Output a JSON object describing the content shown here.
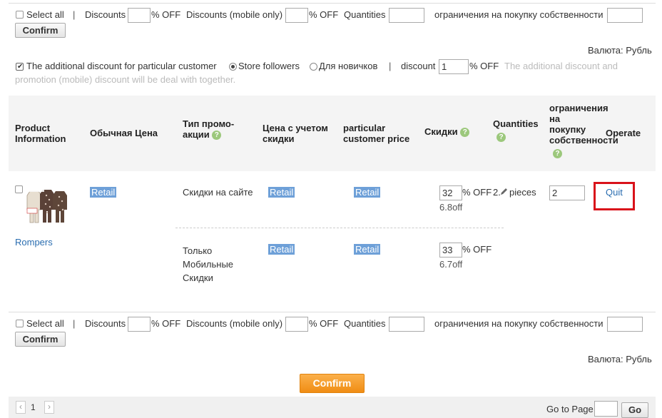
{
  "bulk_top": {
    "select_all": "Select all",
    "separator": "|",
    "discounts_label": "Discounts",
    "off_label": "% OFF",
    "discounts_mobile_label": "Discounts (mobile only)",
    "quantities_label": "Quantities",
    "restrictions_label": "ограничения на покупку собственности",
    "confirm": "Confirm"
  },
  "currency": "Валюта: Рубль",
  "customer_discount": {
    "label": "The additional discount for particular customer",
    "option_followers": "Store followers",
    "option_newcomers": "Для новичков",
    "separator": "|",
    "discount_label": "discount",
    "discount_value": "1",
    "off_label": "% OFF",
    "note_line1": "The additional discount and",
    "note_line2": "promotion (mobile) discount will be deal with together."
  },
  "table": {
    "headers": {
      "product_1": "Product",
      "product_2": "Information",
      "price": "Обычная Цена",
      "promo_type_1": "Тип промо-",
      "promo_type_2": "акции",
      "discounted_price_1": "Цена с учетом",
      "discounted_price_2": "скидки",
      "customer_price_1": "particular",
      "customer_price_2": "customer price",
      "discounts": "Скидки",
      "quantities": "Quantities",
      "restrictions_1": "ограничения",
      "restrictions_2": "на",
      "restrictions_3": "покупку",
      "restrictions_4": "собственности",
      "operate": "Operate"
    },
    "help_glyph": "?",
    "product": {
      "name": "Rompers",
      "price_tag": "Retail",
      "rows": [
        {
          "promo_type": "Скидки на сайте",
          "discounted_tag": "Retail",
          "customer_tag": "Retail",
          "discount_value": "32",
          "off_label": "% OFF",
          "off_amount": "6.8off",
          "quantity_prefix": "2.",
          "quantity_unit": "pieces",
          "restriction_value": "2",
          "operate": "Quit"
        },
        {
          "promo_type_1": "Только",
          "promo_type_2": "Мобильные",
          "promo_type_3": "Скидки",
          "discounted_tag": "Retail",
          "customer_tag": "Retail",
          "discount_value": "33",
          "off_label": "% OFF",
          "off_amount": "6.7off"
        }
      ]
    }
  },
  "bulk_bottom": {
    "select_all": "Select all",
    "separator": "|",
    "discounts_label": "Discounts",
    "off_label": "% OFF",
    "discounts_mobile_label": "Discounts (mobile only)",
    "quantities_label": "Quantities",
    "restrictions_label": "ограничения на покупку собственности",
    "confirm": "Confirm"
  },
  "final_confirm": "Confirm",
  "pager": {
    "prev": "‹",
    "page": "1",
    "next": "›",
    "goto_label": "Go to Page",
    "go": "Go"
  },
  "colors": {
    "accent_orange": "#f39a1e",
    "link_blue": "#2a6db0",
    "tag_blue": "#6ea0d8",
    "highlight_red": "#d9121a",
    "help_green": "#9cc87c"
  }
}
